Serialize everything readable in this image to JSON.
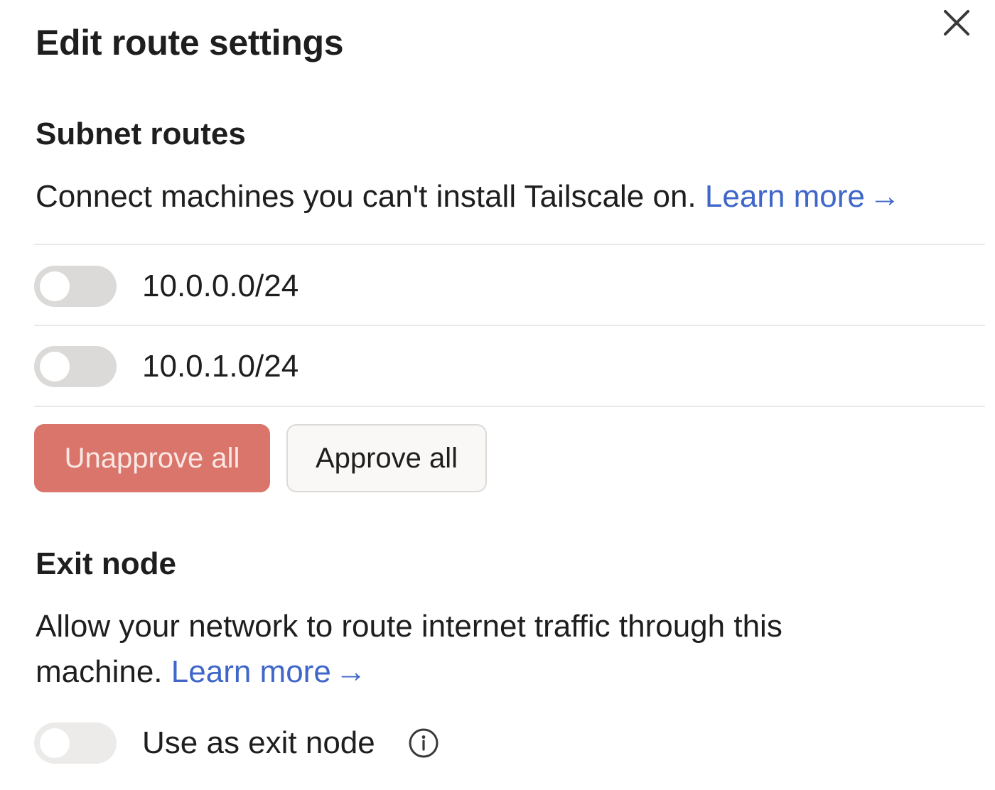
{
  "dialog": {
    "title": "Edit route settings",
    "close_label": "×"
  },
  "subnet": {
    "heading": "Subnet routes",
    "description": "Connect machines you can't install Tailscale on.",
    "link_text": "Learn more",
    "link_arrow": "→",
    "routes": [
      {
        "cidr": "10.0.0.0/24",
        "enabled": false
      },
      {
        "cidr": "10.0.1.0/24",
        "enabled": false
      }
    ],
    "unapprove_all_label": "Unapprove all",
    "approve_all_label": "Approve all"
  },
  "exit_node": {
    "heading": "Exit node",
    "description_line1": "Allow your network to route internet traffic through this",
    "description_line2": "machine.",
    "link_text": "Learn more",
    "link_arrow": "→",
    "toggle_label": "Use as exit node",
    "toggle_enabled": false,
    "toggle_disabled": true
  },
  "colors": {
    "link": "#3f66c8",
    "danger_button": "#d9756b",
    "toggle_off": "#dcdad8",
    "divider": "#ebe9e7"
  },
  "icons": {
    "close": "close-icon",
    "arrow": "arrow-right-icon",
    "info": "info-icon"
  }
}
